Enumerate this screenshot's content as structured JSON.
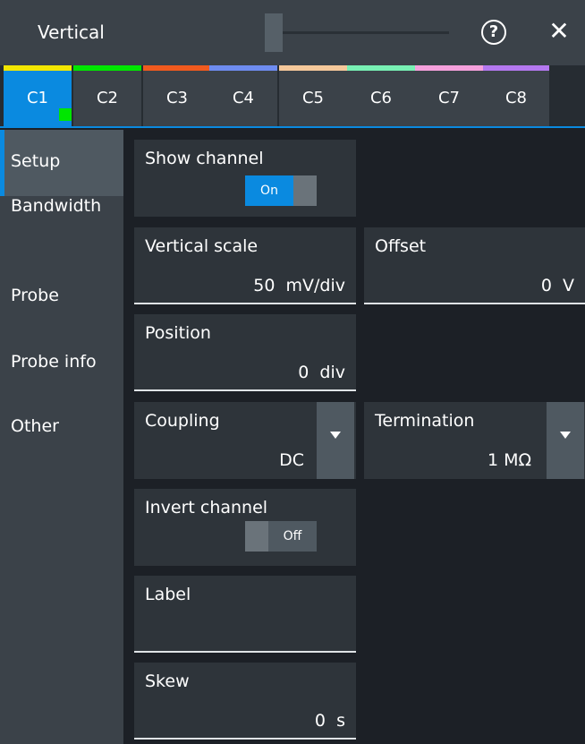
{
  "window": {
    "title": "Vertical",
    "help_symbol": "?",
    "close_symbol": "✕"
  },
  "channels": [
    {
      "label": "C1",
      "color": "#f2e600",
      "active": true
    },
    {
      "label": "C2",
      "color": "#00e600"
    },
    {
      "label": "C3",
      "color": "#f05a1e"
    },
    {
      "label": "C4",
      "color": "#6e8cf0"
    },
    {
      "label": "C5",
      "color": "#f5c89a"
    },
    {
      "label": "C6",
      "color": "#78f0b4"
    },
    {
      "label": "C7",
      "color": "#f5a0dc"
    },
    {
      "label": "C8",
      "color": "#b478f0"
    }
  ],
  "sidebar": {
    "items": [
      {
        "label": "Setup",
        "active": true
      },
      {
        "label": "Bandwidth"
      },
      {
        "label": "Probe"
      },
      {
        "label": "Probe info"
      },
      {
        "label": "Other"
      }
    ]
  },
  "setup": {
    "show_channel": {
      "label": "Show channel",
      "state": "On"
    },
    "vertical_scale": {
      "label": "Vertical scale",
      "value": "50  mV/div"
    },
    "offset": {
      "label": "Offset",
      "value": "0  V"
    },
    "position": {
      "label": "Position",
      "value": "0  div"
    },
    "coupling": {
      "label": "Coupling",
      "value": "DC"
    },
    "termination": {
      "label": "Termination",
      "value": "1 MΩ"
    },
    "invert_channel": {
      "label": "Invert channel",
      "state": "Off"
    },
    "label": {
      "label": "Label",
      "value": ""
    },
    "skew": {
      "label": "Skew",
      "value": "0  s"
    }
  },
  "colors": {
    "accent": "#0a8ae0",
    "panel": "#2e343a",
    "background": "#1c2026"
  }
}
